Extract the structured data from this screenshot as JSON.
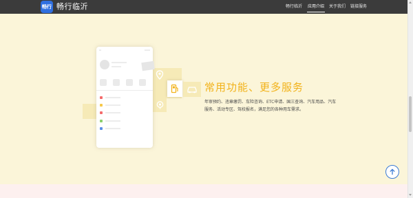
{
  "header": {
    "logo_text": "畅行",
    "brand": "畅行临沂",
    "nav": [
      {
        "label": "畅行临沂",
        "active": false
      },
      {
        "label": "应用介绍",
        "active": true
      },
      {
        "label": "关于我们",
        "active": false
      },
      {
        "label": "链接服务",
        "active": false
      }
    ]
  },
  "feature": {
    "title": "常用功能、更多服务",
    "description": "年审预约、违章缴罚、车险咨询、ETC申请、国三查询、汽车用品、汽车服务、活动专区、驾校报名，满足您的各种用车需求。"
  },
  "illustration": {
    "list_colors": [
      "#f46b6b",
      "#f6c84a",
      "#f46b6b",
      "#8bcf6b",
      "#5b8fe6"
    ],
    "icons": [
      "location-pin-icon",
      "fuel-pump-icon",
      "car-icon",
      "location-target-icon"
    ],
    "accent": "#f2b21a"
  },
  "controls": {
    "back_to_top": "back-to-top-icon"
  },
  "colors": {
    "nav_bg": "#3b3b3b",
    "page_bg": "#fbf5d9",
    "accent": "#f2b21a",
    "logo_bg": "#2f6fe0",
    "scroll_button": "#3b7bd4"
  }
}
